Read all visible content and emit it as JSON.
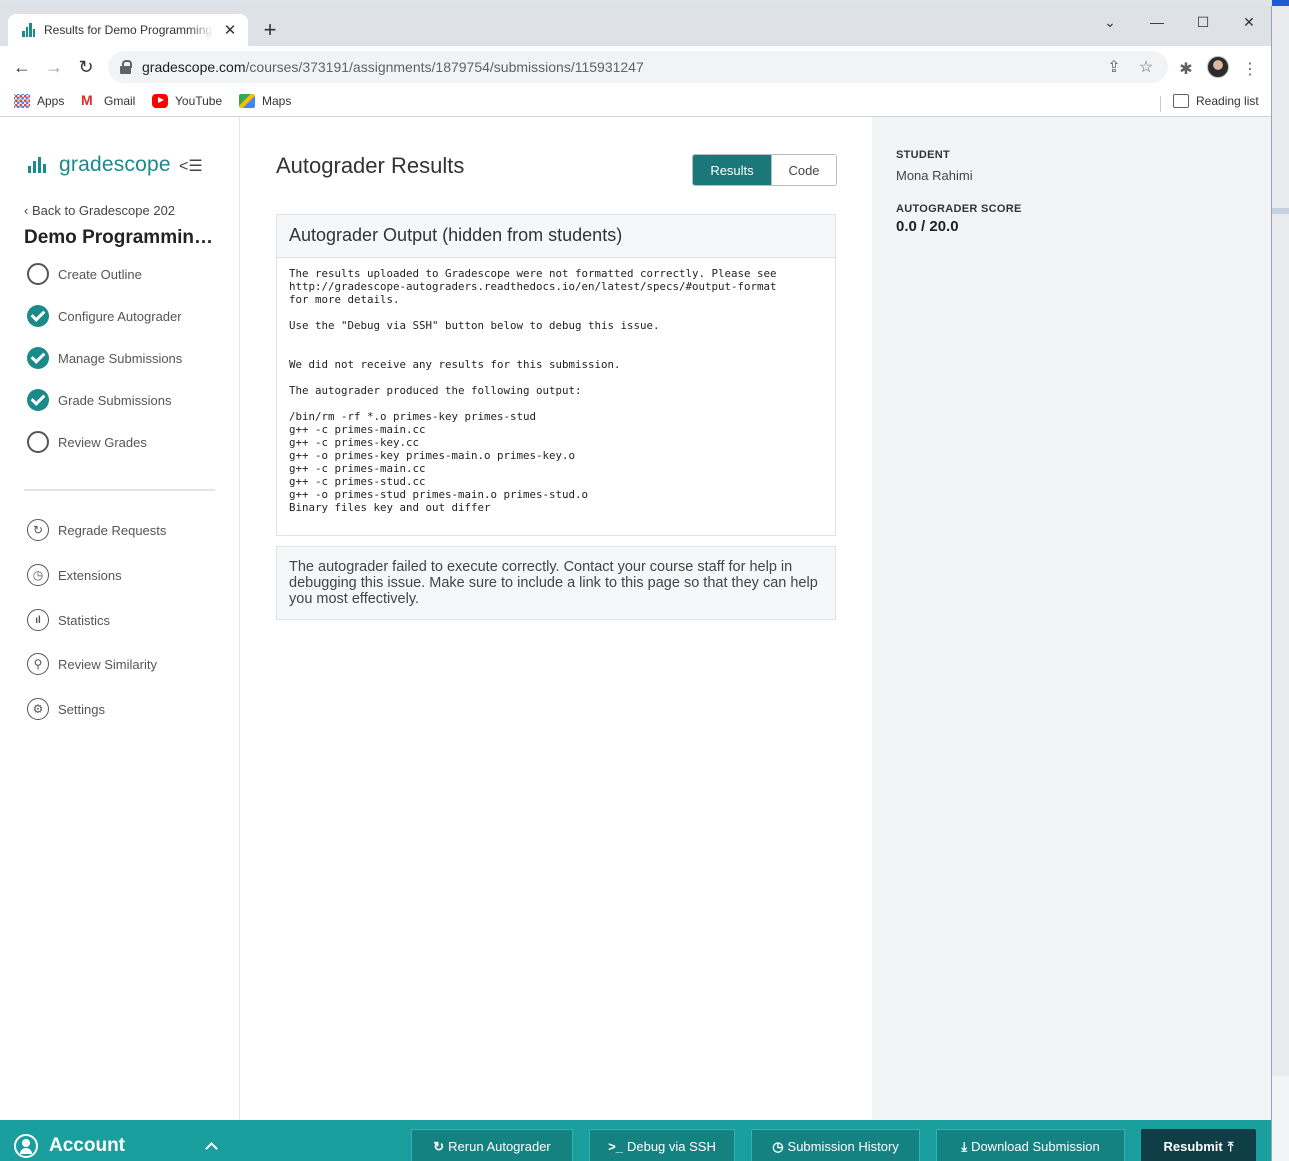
{
  "browser": {
    "tab_title": "Results for Demo Programming Assignment",
    "tab_close": "✕",
    "new_tab": "+",
    "url_host": "gradescope.com",
    "url_path": "/courses/373191/assignments/1879754/submissions/115931247",
    "bookmarks": [
      {
        "label": "Apps"
      },
      {
        "label": "Gmail"
      },
      {
        "label": "YouTube"
      },
      {
        "label": "Maps"
      }
    ],
    "reading_list": "Reading list"
  },
  "sidebar": {
    "logo_text": "gradescope",
    "collapse_glyph": "<☰",
    "back_link": "‹ Back to Gradescope 202",
    "course_title": "Demo Programming Assignment",
    "steps": [
      {
        "label": "Create Outline",
        "done": false
      },
      {
        "label": "Configure Autograder",
        "done": true
      },
      {
        "label": "Manage Submissions",
        "done": true
      },
      {
        "label": "Grade Submissions",
        "done": true
      },
      {
        "label": "Review Grades",
        "done": false
      }
    ],
    "tools": [
      {
        "label": "Regrade Requests",
        "icon": "regrade-icon"
      },
      {
        "label": "Extensions",
        "icon": "clock-icon"
      },
      {
        "label": "Statistics",
        "icon": "statistics-icon"
      },
      {
        "label": "Review Similarity",
        "icon": "magnifier-icon"
      },
      {
        "label": "Settings",
        "icon": "gear-icon"
      }
    ],
    "account_label": "Account"
  },
  "main": {
    "title": "Autograder Results",
    "tabs": [
      {
        "label": "Results",
        "active": true
      },
      {
        "label": "Code",
        "active": false
      }
    ],
    "output_panel": {
      "heading": "Autograder Output (hidden from students)",
      "text": "The results uploaded to Gradescope were not formatted correctly. Please see\nhttp://gradescope-autograders.readthedocs.io/en/latest/specs/#output-format\nfor more details.\n\nUse the \"Debug via SSH\" button below to debug this issue.\n\n\nWe did not receive any results for this submission.\n\nThe autograder produced the following output:\n\n/bin/rm -rf *.o primes-key primes-stud\ng++ -c primes-main.cc\ng++ -c primes-key.cc\ng++ -o primes-key primes-main.o primes-key.o\ng++ -c primes-main.cc\ng++ -c primes-stud.cc\ng++ -o primes-stud primes-main.o primes-stud.o\nBinary files key and out differ"
    },
    "failure_message": "The autograder failed to execute correctly. Contact your course staff for help in debugging this issue. Make sure to include a link to this page so that they can help you most effectively."
  },
  "info": {
    "student_label": "STUDENT",
    "student_name": "Mona Rahimi",
    "score_label": "AUTOGRADER SCORE",
    "score_value": "0.0 / 20.0"
  },
  "footer": {
    "buttons": [
      {
        "label": "Rerun Autograder",
        "glyph": "↻"
      },
      {
        "label": "Debug via SSH",
        "glyph": ">_"
      },
      {
        "label": "Submission History",
        "glyph": "◷"
      },
      {
        "label": "Download Submission",
        "glyph": "⤓"
      },
      {
        "label": "Resubmit",
        "glyph": "⤒"
      }
    ]
  },
  "colors": {
    "brand_teal": "#1a8a8a",
    "active_tab": "#1a7878",
    "footer_bg": "#1b9e9e",
    "primary_button": "#0f3e46"
  }
}
